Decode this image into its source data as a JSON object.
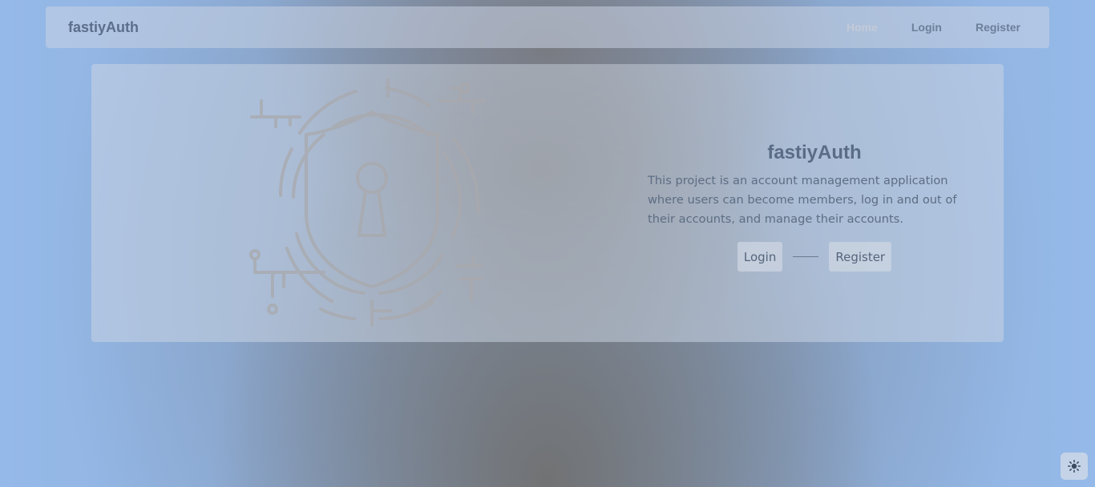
{
  "navbar": {
    "brand": "fastiyAuth",
    "links": [
      {
        "label": "Home",
        "active": true
      },
      {
        "label": "Login",
        "active": false
      },
      {
        "label": "Register",
        "active": false
      }
    ]
  },
  "hero": {
    "illustration_icon": "shield-keyhole-circuit-icon",
    "title": "fastiyAuth",
    "description": "This project is an account management application where users can become members, log in and out of their accounts, and manage their accounts.",
    "login_label": "Login",
    "register_label": "Register"
  },
  "theme_toggle": {
    "icon": "sun-icon"
  },
  "colors": {
    "brand_text": "#5b6f8c",
    "active_link": "#c2cad8",
    "background_blue": "#95b9e8"
  }
}
